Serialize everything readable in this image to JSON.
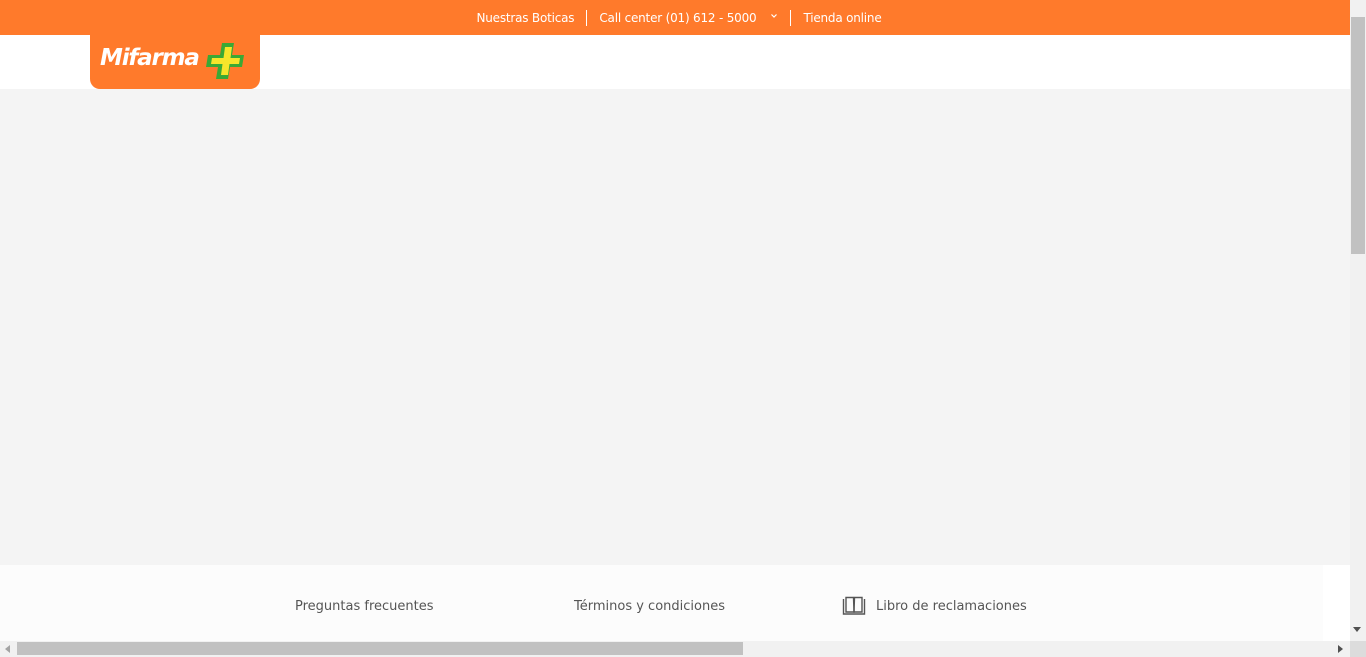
{
  "topbar": {
    "links": {
      "boticas": "Nuestras Boticas",
      "callcenter": "Call center (01) 612 - 5000",
      "tienda": "Tienda online"
    }
  },
  "logo": {
    "text": "Mifarma",
    "icon": "cross-icon"
  },
  "footer": {
    "preguntas": "Preguntas frecuentes",
    "terminos": "Términos y condiciones",
    "libro": "Libro de reclamaciones",
    "libro_icon": "book-icon"
  },
  "colors": {
    "brand_orange": "#ff7a2b",
    "cross_green": "#3aa935",
    "cross_yellow": "#f6e52b",
    "main_bg": "#f4f4f4"
  }
}
